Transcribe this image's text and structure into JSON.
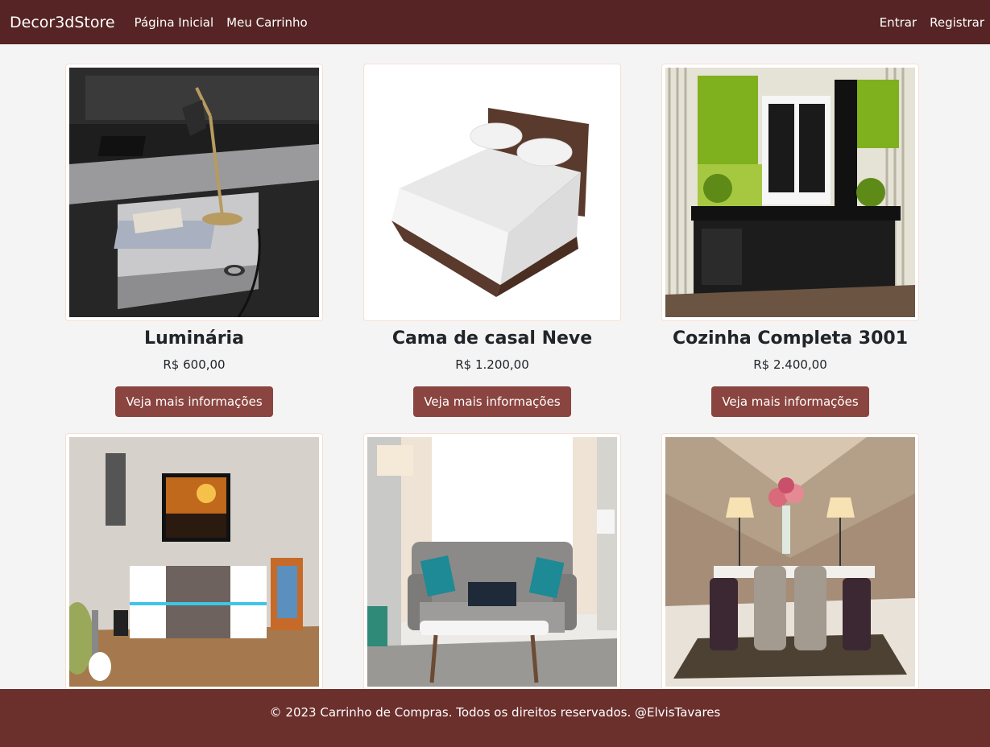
{
  "navbar": {
    "brand": "Decor3dStore",
    "links": [
      "Página Inicial",
      "Meu Carrinho"
    ],
    "auth": [
      "Entrar",
      "Registrar"
    ]
  },
  "products": [
    {
      "name": "Luminária",
      "price": "R$ 600,00",
      "button": "Veja mais informações",
      "image": "desk-lamp-scene"
    },
    {
      "name": "Cama de casal Neve",
      "price": "R$ 1.200,00",
      "button": "Veja mais informações",
      "image": "double-bed"
    },
    {
      "name": "Cozinha Completa 3001",
      "price": "R$ 2.400,00",
      "button": "Veja mais informações",
      "image": "kitchen-green-cabinets"
    },
    {
      "image": "tv-stand-room"
    },
    {
      "image": "living-room-sofa"
    },
    {
      "image": "dining-room-table"
    }
  ],
  "footer": {
    "text": "© 2023 Carrinho de Compras. Todos os direitos reservados. @ElvisTavares"
  },
  "colors": {
    "navbar": "#562424",
    "footer": "#6b2f2c",
    "button": "#8a4540",
    "page_bg": "#f4f4f4"
  }
}
